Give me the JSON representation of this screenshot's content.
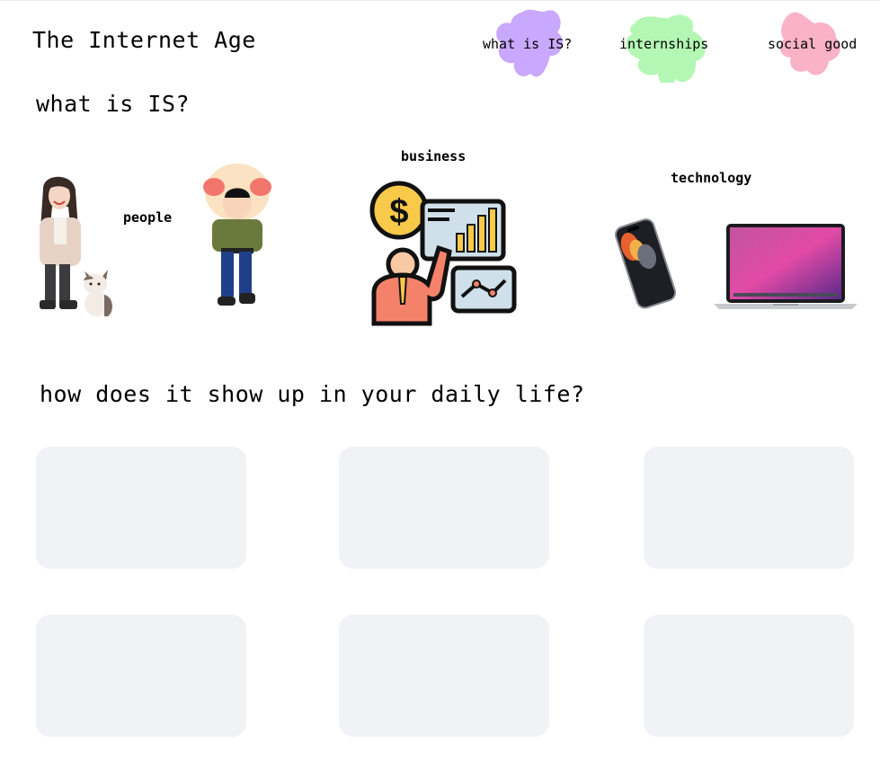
{
  "site": {
    "title": "The Internet Age"
  },
  "nav": {
    "items": [
      {
        "label": "what is IS?",
        "color": "#c9a8ff"
      },
      {
        "label": "internships",
        "color": "#b4f7b4"
      },
      {
        "label": "social good",
        "color": "#f9b2c6"
      }
    ]
  },
  "what_is": {
    "title": "what is IS?",
    "labels": {
      "people": "people",
      "business": "business",
      "technology": "technology"
    }
  },
  "daily": {
    "title": "how does it show up in your daily life?"
  },
  "colors": {
    "card_bg": "#f1f2f6",
    "accent_orange": "#f4826a",
    "accent_yellow": "#f9c94a"
  }
}
